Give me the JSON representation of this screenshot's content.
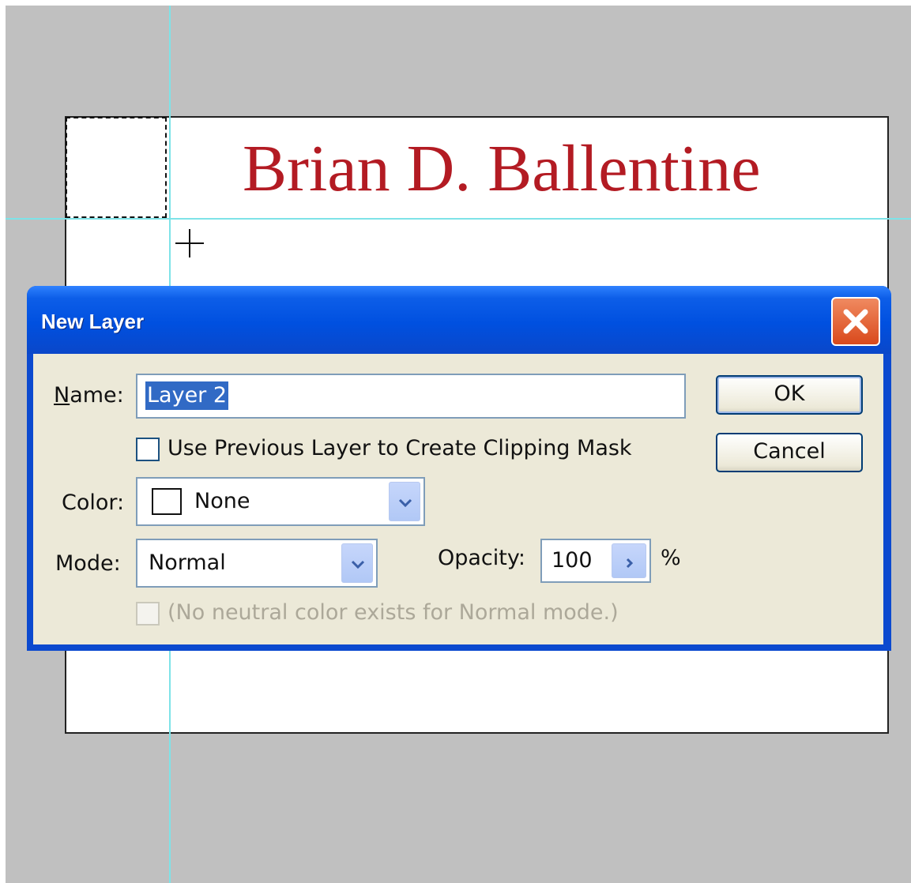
{
  "document": {
    "heading": "Brian D. Ballentine"
  },
  "dialog": {
    "title": "New Layer",
    "name_label": "Name:",
    "name_value": "Layer 2",
    "clipping_label": "Use Previous Layer to Create Clipping Mask",
    "color_label": "Color:",
    "color_value": "None",
    "mode_label": "Mode:",
    "mode_value": "Normal",
    "opacity_label": "Opacity:",
    "opacity_value": "100",
    "opacity_unit": "%",
    "neutral_label": "(No neutral color exists for Normal mode.)",
    "ok_label": "OK",
    "cancel_label": "Cancel"
  },
  "colors": {
    "heading_text": "#b31b23",
    "titlebar": "#0050e0",
    "dialog_body": "#ece9d8",
    "guide": "#7ee3e8",
    "selection": "#316ac5"
  },
  "icons": [
    "close-icon",
    "chevron-down-icon",
    "chevron-right-icon",
    "crosshair-cursor-icon"
  ]
}
